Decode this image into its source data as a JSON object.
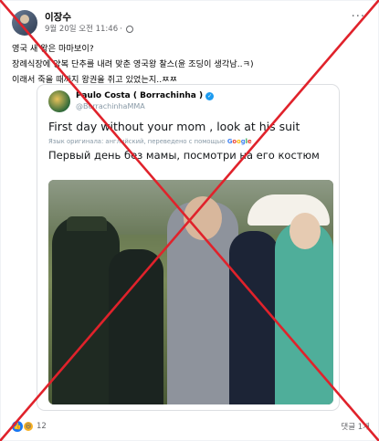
{
  "post": {
    "author": "이장수",
    "timestamp": "9월 20일 오전 11:46",
    "more_label": "···",
    "lines": [
      "영국 새 왕은 마마보이?",
      "장례식장에 양복 단추를 내려 맞춘 영국왕 찰스(윤 조딩이 생각남..ㅋ)",
      "이래서 죽을 때까지 왕권을 쥐고 있었는지..ㅉㅉ"
    ]
  },
  "tweet": {
    "name": "Paulo Costa ( Borrachinha )",
    "handle": "@BorrachinhaMMA",
    "text_en": "First day without your mom , look at his suit",
    "translation_note": "Язык оригинала: английский, переведено с помощью",
    "google_letters": [
      "G",
      "o",
      "o",
      "g",
      "l",
      "e"
    ],
    "text_ru": "Первый день без мамы, посмотри на его костюм"
  },
  "footer": {
    "reaction_count": "12",
    "comments": "댓글 1개"
  },
  "colors": {
    "facebook_blue": "#1877f2",
    "cross_red": "#e0222b",
    "verified_blue": "#1d9bf0"
  },
  "icons": {
    "globe": "globe-icon",
    "like": "like-icon",
    "haha": "haha-icon",
    "more": "more-options-icon",
    "verified": "verified-badge-icon"
  }
}
